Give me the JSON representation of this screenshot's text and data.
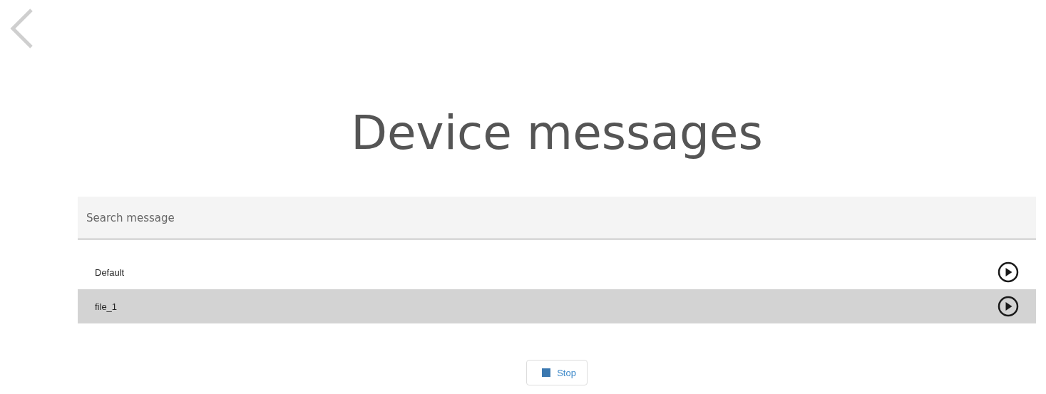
{
  "title": "Device messages",
  "search": {
    "placeholder": "Search message"
  },
  "messages": [
    {
      "name": "Default",
      "selected": false
    },
    {
      "name": "file_1",
      "selected": true
    }
  ],
  "stop_button": {
    "label": "Stop"
  }
}
